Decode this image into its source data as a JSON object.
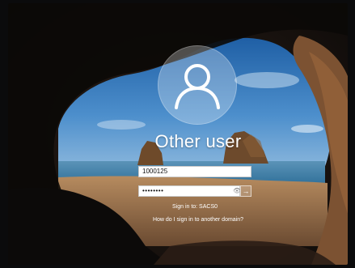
{
  "login": {
    "username_display": "Other user",
    "user_field_value": "1000125",
    "password_field_masked": "••••••••",
    "signin_to_text": "Sign in to: SACS0",
    "other_domain_link": "How do I sign in to another domain?"
  },
  "icons": {
    "avatar": "user-silhouette-icon",
    "reveal": "eye-icon",
    "submit": "arrow-right-icon"
  },
  "colors": {
    "sky": "#2f74b5",
    "sea": "#4c8db7",
    "cave": "#1c1410"
  }
}
